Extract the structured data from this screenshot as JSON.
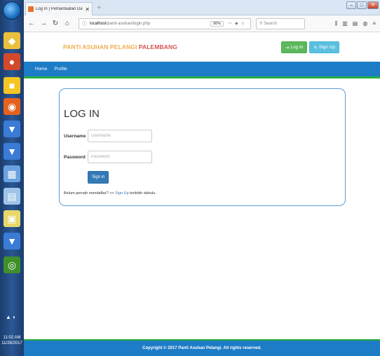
{
  "browser": {
    "tab_title": "Log In | Pemanfaatan Dana Un",
    "url_host": "localhost",
    "url_path": "/panti-asuhan/login.php",
    "zoom": "90%",
    "search_placeholder": "Search"
  },
  "taskbar": {
    "time": "11:02 AM",
    "date": "11/28/2017"
  },
  "header": {
    "brand_main": "PANTI ASUHAN PELANGI ",
    "brand_accent": "PALEMBANG",
    "login_label": "Log In",
    "signup_label": "Sign Up"
  },
  "nav": {
    "items": [
      {
        "label": "Home"
      },
      {
        "label": "Profile"
      }
    ]
  },
  "login": {
    "title": "LOG IN",
    "username_label": "Username",
    "username_placeholder": "Username",
    "password_label": "Password",
    "password_placeholder": "Password",
    "submit_label": "Sign in",
    "hint_prefix": "Belum pernah mendaftar? >> ",
    "hint_link": "Sign Up",
    "hint_suffix": " terlebih dahulu."
  },
  "footer": {
    "text": "Copyright © 2017 Panti Asuhan Pelangi. All rights reserved."
  },
  "colors": {
    "nav_blue": "#1d7cc6",
    "accent_green": "#27ae3f",
    "brand_orange": "#f0ad4e",
    "brand_red": "#d9534f"
  }
}
